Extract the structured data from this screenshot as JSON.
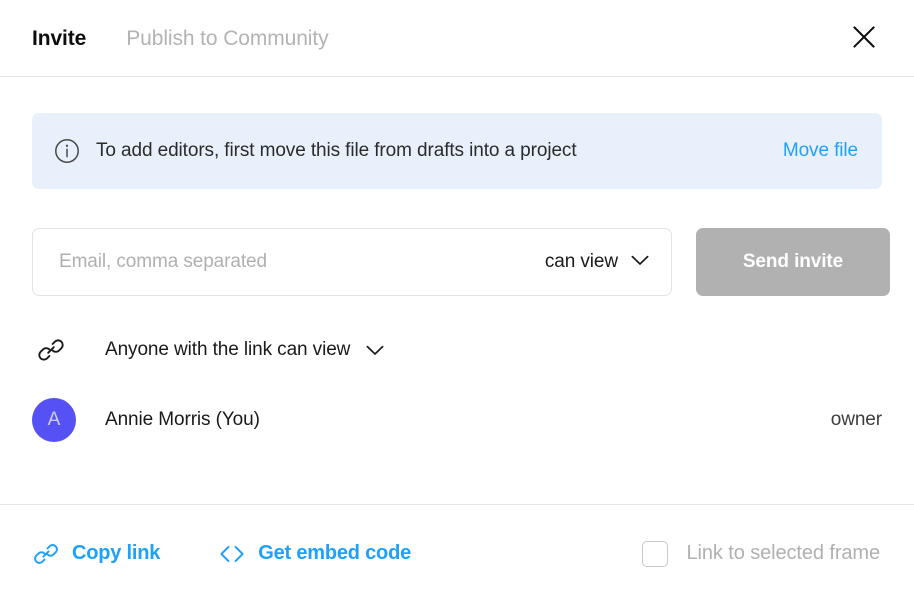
{
  "dialog": {
    "tabs": [
      {
        "label": "Invite",
        "active": true
      },
      {
        "label": "Publish to Community",
        "active": false
      }
    ],
    "close_icon": "close-icon"
  },
  "banner": {
    "icon": "info-circle-icon",
    "message": "To add editors, first move this file from drafts into a project",
    "action_label": "Move file",
    "background_color": "#e8f1fb",
    "link_color": "#1fa0fa"
  },
  "invite": {
    "email_placeholder": "Email, comma separated",
    "email_value": "",
    "permission_label": "can view",
    "permission_chevron": "chevron-down-icon",
    "send_label": "Send invite",
    "send_disabled_color": "#b1b1b1"
  },
  "link_access": {
    "icon": "link-chain-icon",
    "label": "Anyone with the link can view",
    "chevron": "chevron-down-icon"
  },
  "members": [
    {
      "avatar_initial": "A",
      "avatar_color": "#5551f5",
      "name": "Annie Morris (You)",
      "role": "owner"
    }
  ],
  "footer": {
    "copy_link": {
      "icon": "link-chain-icon",
      "label": "Copy link"
    },
    "embed_code": {
      "icon": "code-brackets-icon",
      "label": "Get embed code"
    },
    "frame_checkbox": {
      "label": "Link to selected frame",
      "checked": false
    }
  }
}
